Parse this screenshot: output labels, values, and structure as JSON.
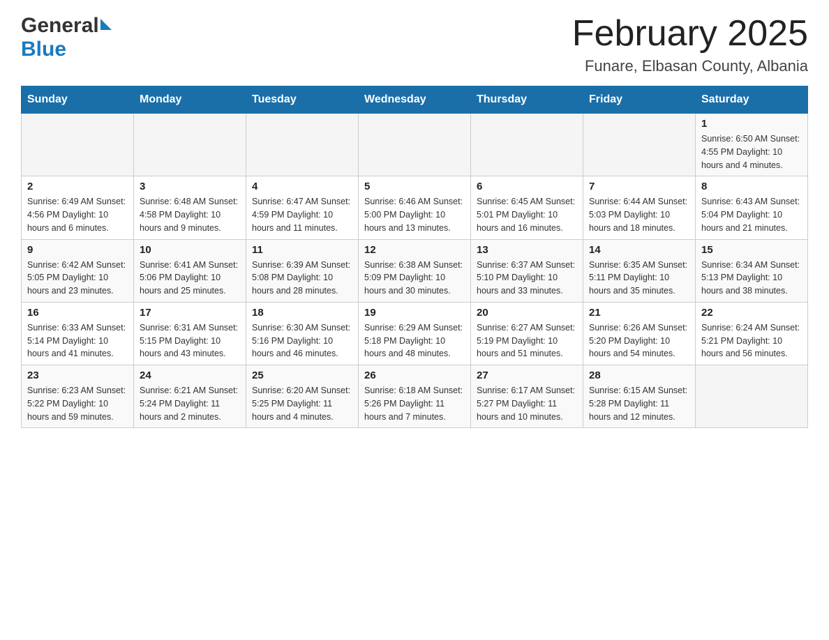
{
  "header": {
    "logo": {
      "general": "General",
      "blue": "Blue"
    },
    "title": "February 2025",
    "location": "Funare, Elbasan County, Albania"
  },
  "calendar": {
    "days_of_week": [
      "Sunday",
      "Monday",
      "Tuesday",
      "Wednesday",
      "Thursday",
      "Friday",
      "Saturday"
    ],
    "weeks": [
      [
        {
          "day": "",
          "info": ""
        },
        {
          "day": "",
          "info": ""
        },
        {
          "day": "",
          "info": ""
        },
        {
          "day": "",
          "info": ""
        },
        {
          "day": "",
          "info": ""
        },
        {
          "day": "",
          "info": ""
        },
        {
          "day": "1",
          "info": "Sunrise: 6:50 AM\nSunset: 4:55 PM\nDaylight: 10 hours and 4 minutes."
        }
      ],
      [
        {
          "day": "2",
          "info": "Sunrise: 6:49 AM\nSunset: 4:56 PM\nDaylight: 10 hours and 6 minutes."
        },
        {
          "day": "3",
          "info": "Sunrise: 6:48 AM\nSunset: 4:58 PM\nDaylight: 10 hours and 9 minutes."
        },
        {
          "day": "4",
          "info": "Sunrise: 6:47 AM\nSunset: 4:59 PM\nDaylight: 10 hours and 11 minutes."
        },
        {
          "day": "5",
          "info": "Sunrise: 6:46 AM\nSunset: 5:00 PM\nDaylight: 10 hours and 13 minutes."
        },
        {
          "day": "6",
          "info": "Sunrise: 6:45 AM\nSunset: 5:01 PM\nDaylight: 10 hours and 16 minutes."
        },
        {
          "day": "7",
          "info": "Sunrise: 6:44 AM\nSunset: 5:03 PM\nDaylight: 10 hours and 18 minutes."
        },
        {
          "day": "8",
          "info": "Sunrise: 6:43 AM\nSunset: 5:04 PM\nDaylight: 10 hours and 21 minutes."
        }
      ],
      [
        {
          "day": "9",
          "info": "Sunrise: 6:42 AM\nSunset: 5:05 PM\nDaylight: 10 hours and 23 minutes."
        },
        {
          "day": "10",
          "info": "Sunrise: 6:41 AM\nSunset: 5:06 PM\nDaylight: 10 hours and 25 minutes."
        },
        {
          "day": "11",
          "info": "Sunrise: 6:39 AM\nSunset: 5:08 PM\nDaylight: 10 hours and 28 minutes."
        },
        {
          "day": "12",
          "info": "Sunrise: 6:38 AM\nSunset: 5:09 PM\nDaylight: 10 hours and 30 minutes."
        },
        {
          "day": "13",
          "info": "Sunrise: 6:37 AM\nSunset: 5:10 PM\nDaylight: 10 hours and 33 minutes."
        },
        {
          "day": "14",
          "info": "Sunrise: 6:35 AM\nSunset: 5:11 PM\nDaylight: 10 hours and 35 minutes."
        },
        {
          "day": "15",
          "info": "Sunrise: 6:34 AM\nSunset: 5:13 PM\nDaylight: 10 hours and 38 minutes."
        }
      ],
      [
        {
          "day": "16",
          "info": "Sunrise: 6:33 AM\nSunset: 5:14 PM\nDaylight: 10 hours and 41 minutes."
        },
        {
          "day": "17",
          "info": "Sunrise: 6:31 AM\nSunset: 5:15 PM\nDaylight: 10 hours and 43 minutes."
        },
        {
          "day": "18",
          "info": "Sunrise: 6:30 AM\nSunset: 5:16 PM\nDaylight: 10 hours and 46 minutes."
        },
        {
          "day": "19",
          "info": "Sunrise: 6:29 AM\nSunset: 5:18 PM\nDaylight: 10 hours and 48 minutes."
        },
        {
          "day": "20",
          "info": "Sunrise: 6:27 AM\nSunset: 5:19 PM\nDaylight: 10 hours and 51 minutes."
        },
        {
          "day": "21",
          "info": "Sunrise: 6:26 AM\nSunset: 5:20 PM\nDaylight: 10 hours and 54 minutes."
        },
        {
          "day": "22",
          "info": "Sunrise: 6:24 AM\nSunset: 5:21 PM\nDaylight: 10 hours and 56 minutes."
        }
      ],
      [
        {
          "day": "23",
          "info": "Sunrise: 6:23 AM\nSunset: 5:22 PM\nDaylight: 10 hours and 59 minutes."
        },
        {
          "day": "24",
          "info": "Sunrise: 6:21 AM\nSunset: 5:24 PM\nDaylight: 11 hours and 2 minutes."
        },
        {
          "day": "25",
          "info": "Sunrise: 6:20 AM\nSunset: 5:25 PM\nDaylight: 11 hours and 4 minutes."
        },
        {
          "day": "26",
          "info": "Sunrise: 6:18 AM\nSunset: 5:26 PM\nDaylight: 11 hours and 7 minutes."
        },
        {
          "day": "27",
          "info": "Sunrise: 6:17 AM\nSunset: 5:27 PM\nDaylight: 11 hours and 10 minutes."
        },
        {
          "day": "28",
          "info": "Sunrise: 6:15 AM\nSunset: 5:28 PM\nDaylight: 11 hours and 12 minutes."
        },
        {
          "day": "",
          "info": ""
        }
      ]
    ]
  }
}
